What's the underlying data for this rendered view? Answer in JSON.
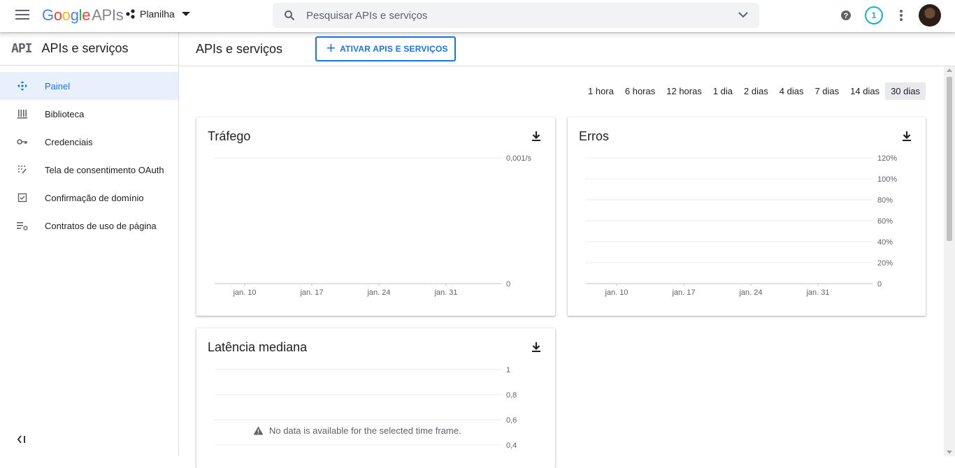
{
  "header": {
    "logo": {
      "google": "Google",
      "apis": "APIs"
    },
    "project": "Planilha",
    "search_placeholder": "Pesquisar APIs e serviços",
    "notification_count": "1"
  },
  "sidebar": {
    "api_badge": "API",
    "title": "APIs e serviços",
    "items": [
      {
        "label": "Painel",
        "icon": "dashboard-icon",
        "active": true
      },
      {
        "label": "Biblioteca",
        "icon": "library-icon",
        "active": false
      },
      {
        "label": "Credenciais",
        "icon": "key-icon",
        "active": false
      },
      {
        "label": "Tela de consentimento OAuth",
        "icon": "oauth-consent-icon",
        "active": false
      },
      {
        "label": "Confirmação de domínio",
        "icon": "domain-check-icon",
        "active": false
      },
      {
        "label": "Contratos de uso de página",
        "icon": "page-agreement-icon",
        "active": false
      }
    ]
  },
  "main": {
    "title": "APIs e serviços",
    "enable_button": "ATIVAR APIS E SERVIÇOS",
    "time_ranges": [
      "1 hora",
      "6 horas",
      "12 horas",
      "1 dia",
      "2 dias",
      "4 dias",
      "7 dias",
      "14 dias",
      "30 dias"
    ],
    "selected_range": "30 dias",
    "no_data_message": "No data is available for the selected time frame."
  },
  "colors": {
    "accent": "#1a73e8",
    "active_bg": "#e8f0fe",
    "notif": "#12b5cb"
  },
  "chart_data": [
    {
      "type": "line",
      "title": "Tráfego",
      "categories": [
        "jan. 10",
        "jan. 17",
        "jan. 24",
        "jan. 31"
      ],
      "y_ticks": [
        "0,001/s",
        "0"
      ],
      "series": [],
      "grid": true
    },
    {
      "type": "line",
      "title": "Erros",
      "categories": [
        "jan. 10",
        "jan. 17",
        "jan. 24",
        "jan. 31"
      ],
      "y_ticks": [
        "120%",
        "100%",
        "80%",
        "60%",
        "40%",
        "20%",
        "0"
      ],
      "series": [],
      "grid": true
    },
    {
      "type": "line",
      "title": "Latência mediana",
      "categories": [],
      "y_ticks": [
        "1",
        "0,8",
        "0,6",
        "0,4"
      ],
      "series": [],
      "grid": true
    }
  ]
}
